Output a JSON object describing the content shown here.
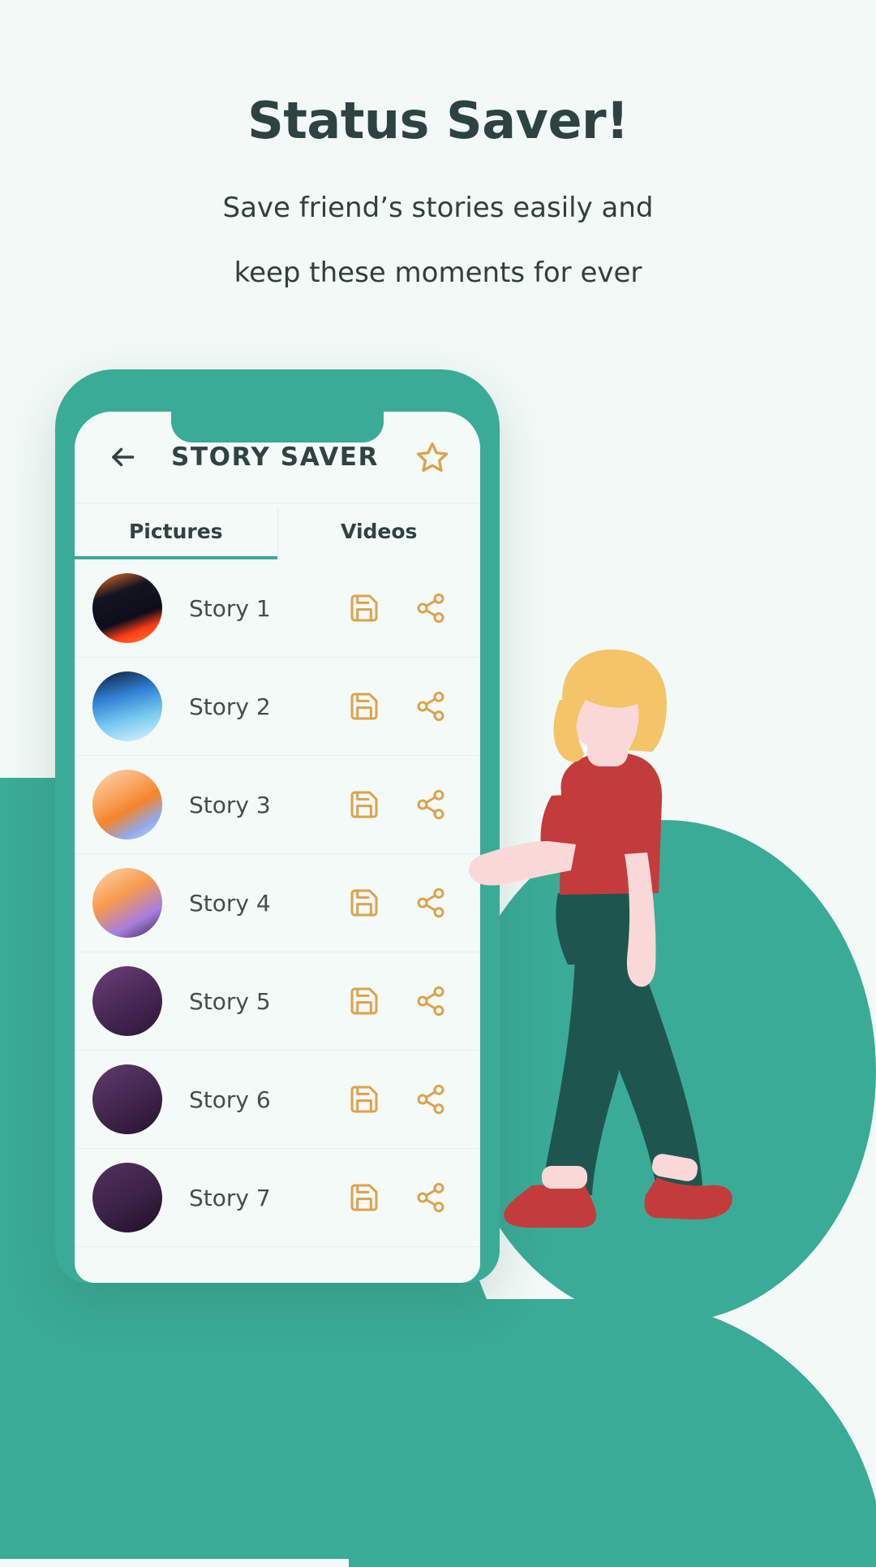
{
  "page": {
    "background_color": "#f2f9f6",
    "accent_teal": "#3aab96",
    "accent_gold": "#dda24f",
    "text_dark": "#2d4340"
  },
  "headline": "Status Saver!",
  "subhead_lines": [
    "Save friend’s stories easily and",
    "keep these moments for ever"
  ],
  "phone": {
    "appbar": {
      "back_icon": "arrow-left-icon",
      "title": "STORY SAVER",
      "favorite_icon": "star-icon"
    },
    "tabs": [
      {
        "label": "Pictures",
        "active": true
      },
      {
        "label": "Videos",
        "active": false
      }
    ],
    "rows": [
      {
        "name": "Story 1",
        "thumb": "linear-gradient(160deg,#f97a28 0%,#141421 30%,#0e0e1a 62%,#ff3d16 78%,#ff8a2b 100%)",
        "save_icon": "save-icon",
        "share_icon": "share-icon"
      },
      {
        "name": "Story 2",
        "thumb": "linear-gradient(165deg,#0d1a2e 0%,#2f7fd4 35%,#76c9ef 65%,#dff4fb 100%)",
        "save_icon": "save-icon",
        "share_icon": "share-icon"
      },
      {
        "name": "Story 3",
        "thumb": "linear-gradient(150deg,#fbd9b4 0%,#f9a05a 38%,#f6842a 55%,#8fa9e8 78%,#cfe0f7 100%)",
        "save_icon": "save-icon",
        "share_icon": "share-icon"
      },
      {
        "name": "Story 4",
        "thumb": "linear-gradient(150deg,#fcd7b2 0%,#f89a4d 40%,#a57ee0 72%,#3c1f3f 100%)",
        "save_icon": "save-icon",
        "share_icon": "share-icon"
      },
      {
        "name": "Story 5",
        "thumb": "linear-gradient(150deg,#6d4079 0%,#4a2a58 48%,#2d1636 100%)",
        "save_icon": "save-icon",
        "share_icon": "share-icon"
      },
      {
        "name": "Story 6",
        "thumb": "linear-gradient(150deg,#5f3a6e 0%,#43284f 50%,#26122c 100%)",
        "save_icon": "save-icon",
        "share_icon": "share-icon"
      },
      {
        "name": "Story 7",
        "thumb": "linear-gradient(150deg,#55305f 0%,#3a2246 55%,#1f0f26 100%)",
        "save_icon": "save-icon",
        "share_icon": "share-icon"
      }
    ]
  },
  "illustration": {
    "name": "woman-walking-illustration",
    "hair_color": "#f3c468",
    "shirt_color": "#c43b3b",
    "pants_color": "#1e564f",
    "skin_color": "#fbd8d8",
    "shoe_color": "#c43b3b"
  }
}
